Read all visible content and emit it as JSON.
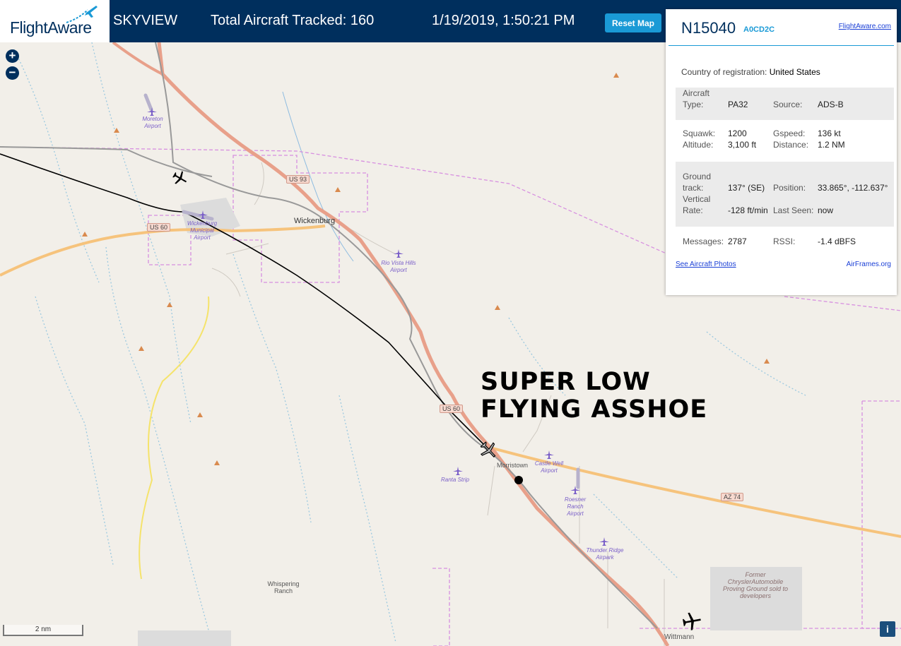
{
  "header": {
    "logo_text": "FlightAware",
    "app_name": "SKYVIEW",
    "total_tracked": "Total Aircraft Tracked: 160",
    "datetime": "1/19/2019, 1:50:21 PM",
    "reset_label": "Reset Map"
  },
  "map": {
    "zoom_in": "+",
    "zoom_out": "−",
    "scale_label": "2 nm",
    "annotation_line1": "SUPER LOW",
    "annotation_line2": "FLYING ASSHOE",
    "places": {
      "wickenburg": "Wickenburg",
      "morristown": "Morristown",
      "wittmann": "Wittmann",
      "whispering": "Whispering Ranch",
      "chrysler": "Former ChryslerAutomobile Proving Ground sold to developers"
    },
    "airports": {
      "moreton": "Moreton Airport",
      "wickenburg_muni": "Wickenburg Municipal Airport",
      "rio_vista": "Rio Vista Hills Airport",
      "castle_well": "Castle Well Airport",
      "ranta": "Ranta Strip",
      "roesner": "Roesner Ranch Airport",
      "thunder_ridge": "Thunder Ridge Airpark"
    },
    "shields": {
      "us93": "US 93",
      "us60_west": "US 60",
      "us60_south": "US 60",
      "az74": "AZ 74"
    }
  },
  "panel": {
    "registration": "N15040",
    "icao": "A0CD2C",
    "flightaware_link": "FlightAware.com",
    "country_label": "Country of registration:",
    "country_value": "United States",
    "aircraft_type_label": "Aircraft Type:",
    "aircraft_type_value": "PA32",
    "source_label": "Source:",
    "source_value": "ADS-B",
    "squawk_label": "Squawk:",
    "squawk_value": "1200",
    "gspeed_label": "Gspeed:",
    "gspeed_value": "136 kt",
    "altitude_label": "Altitude:",
    "altitude_value": "3,100 ft",
    "distance_label": "Distance:",
    "distance_value": "1.2 NM",
    "track_label": "Ground track:",
    "track_value": "137° (SE)",
    "position_label": "Position:",
    "position_value": "33.865°, -112.637°",
    "vrate_label": "Vertical Rate:",
    "vrate_value": "-128 ft/min",
    "last_seen_label": "Last Seen:",
    "last_seen_value": "now",
    "messages_label": "Messages:",
    "messages_value": "2787",
    "rssi_label": "RSSI:",
    "rssi_value": "-1.4 dBFS",
    "photos_link": "See Aircraft Photos",
    "airframes_link": "AirFrames.org"
  },
  "colors": {
    "header_bg": "#002f5d",
    "accent": "#1a9ad6",
    "highway": "#e8a08a",
    "route": "#f6c37c",
    "boundary": "#d78fe0",
    "map_bg": "#f2efe9"
  },
  "icons": {
    "logo": "plane-swoosh-icon",
    "aircraft": "plane-icon",
    "airport": "airport-icon",
    "info": "info-icon"
  }
}
